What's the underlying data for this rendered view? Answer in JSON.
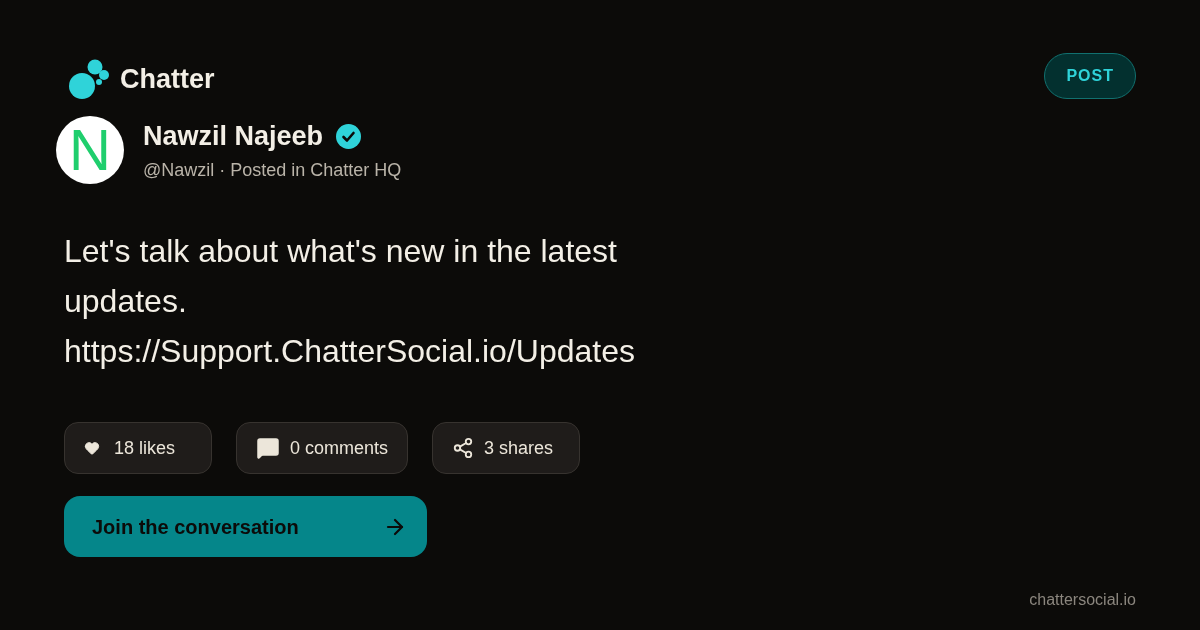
{
  "brand": {
    "name": "Chatter"
  },
  "post_badge": {
    "label": "POST"
  },
  "author": {
    "avatar_initial": "N",
    "name": "Nawzil Najeeb",
    "verified": true,
    "meta": "@Nawzil · Posted in Chatter HQ"
  },
  "post": {
    "text": "Let's talk about what's new in the latest updates. https://Support.ChatterSocial.io/Updates"
  },
  "stats": [
    {
      "kind": "likes",
      "label": "18 likes"
    },
    {
      "kind": "comments",
      "label": "0 comments"
    },
    {
      "kind": "shares",
      "label": "3 shares"
    }
  ],
  "cta": {
    "label": "Join the conversation"
  },
  "footer": {
    "domain": "chattersocial.io"
  }
}
